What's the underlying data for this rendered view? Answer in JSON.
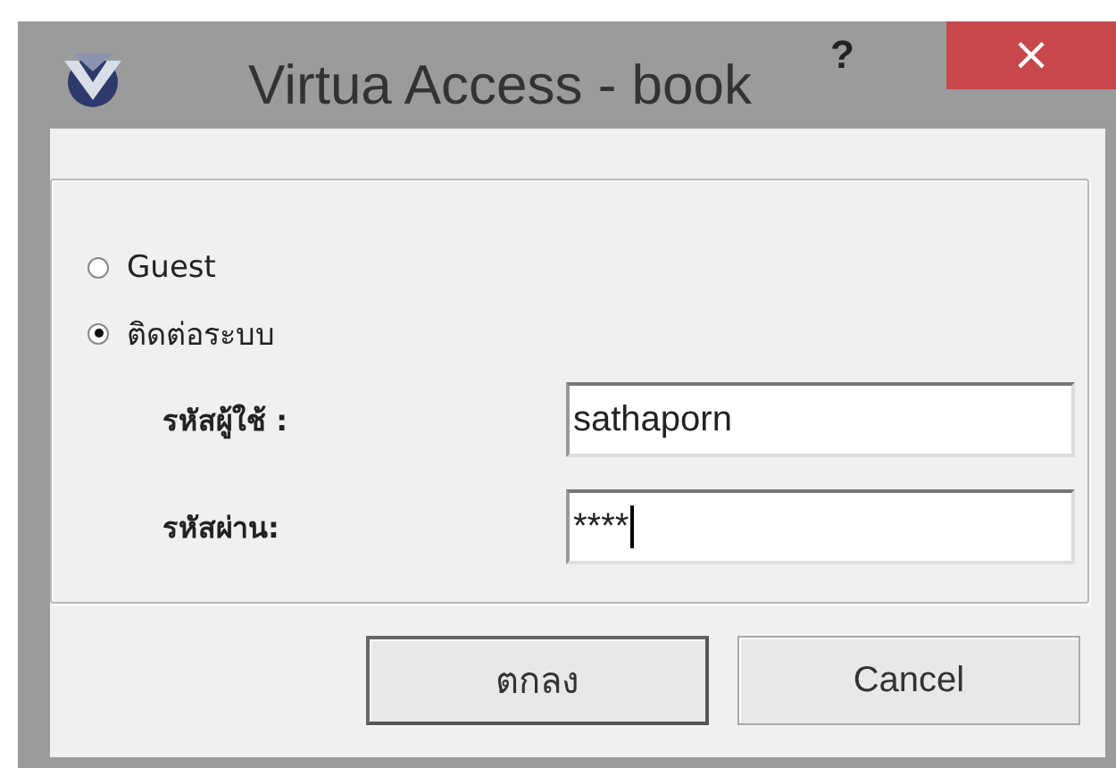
{
  "window": {
    "title": "Virtua Access - book",
    "help": "?",
    "close": "×"
  },
  "options": [
    {
      "label": "Guest",
      "selected": false
    },
    {
      "label": "ติดต่อระบบ",
      "selected": true
    }
  ],
  "fields": [
    {
      "label": "รหัสผู้ใช้ :",
      "value": "sathaporn",
      "focused": false
    },
    {
      "label": "รหัสผ่าน:",
      "value": "****",
      "focused": true
    }
  ],
  "buttons": [
    {
      "label": "ตกลง",
      "default": true
    },
    {
      "label": "Cancel",
      "default": false
    }
  ]
}
